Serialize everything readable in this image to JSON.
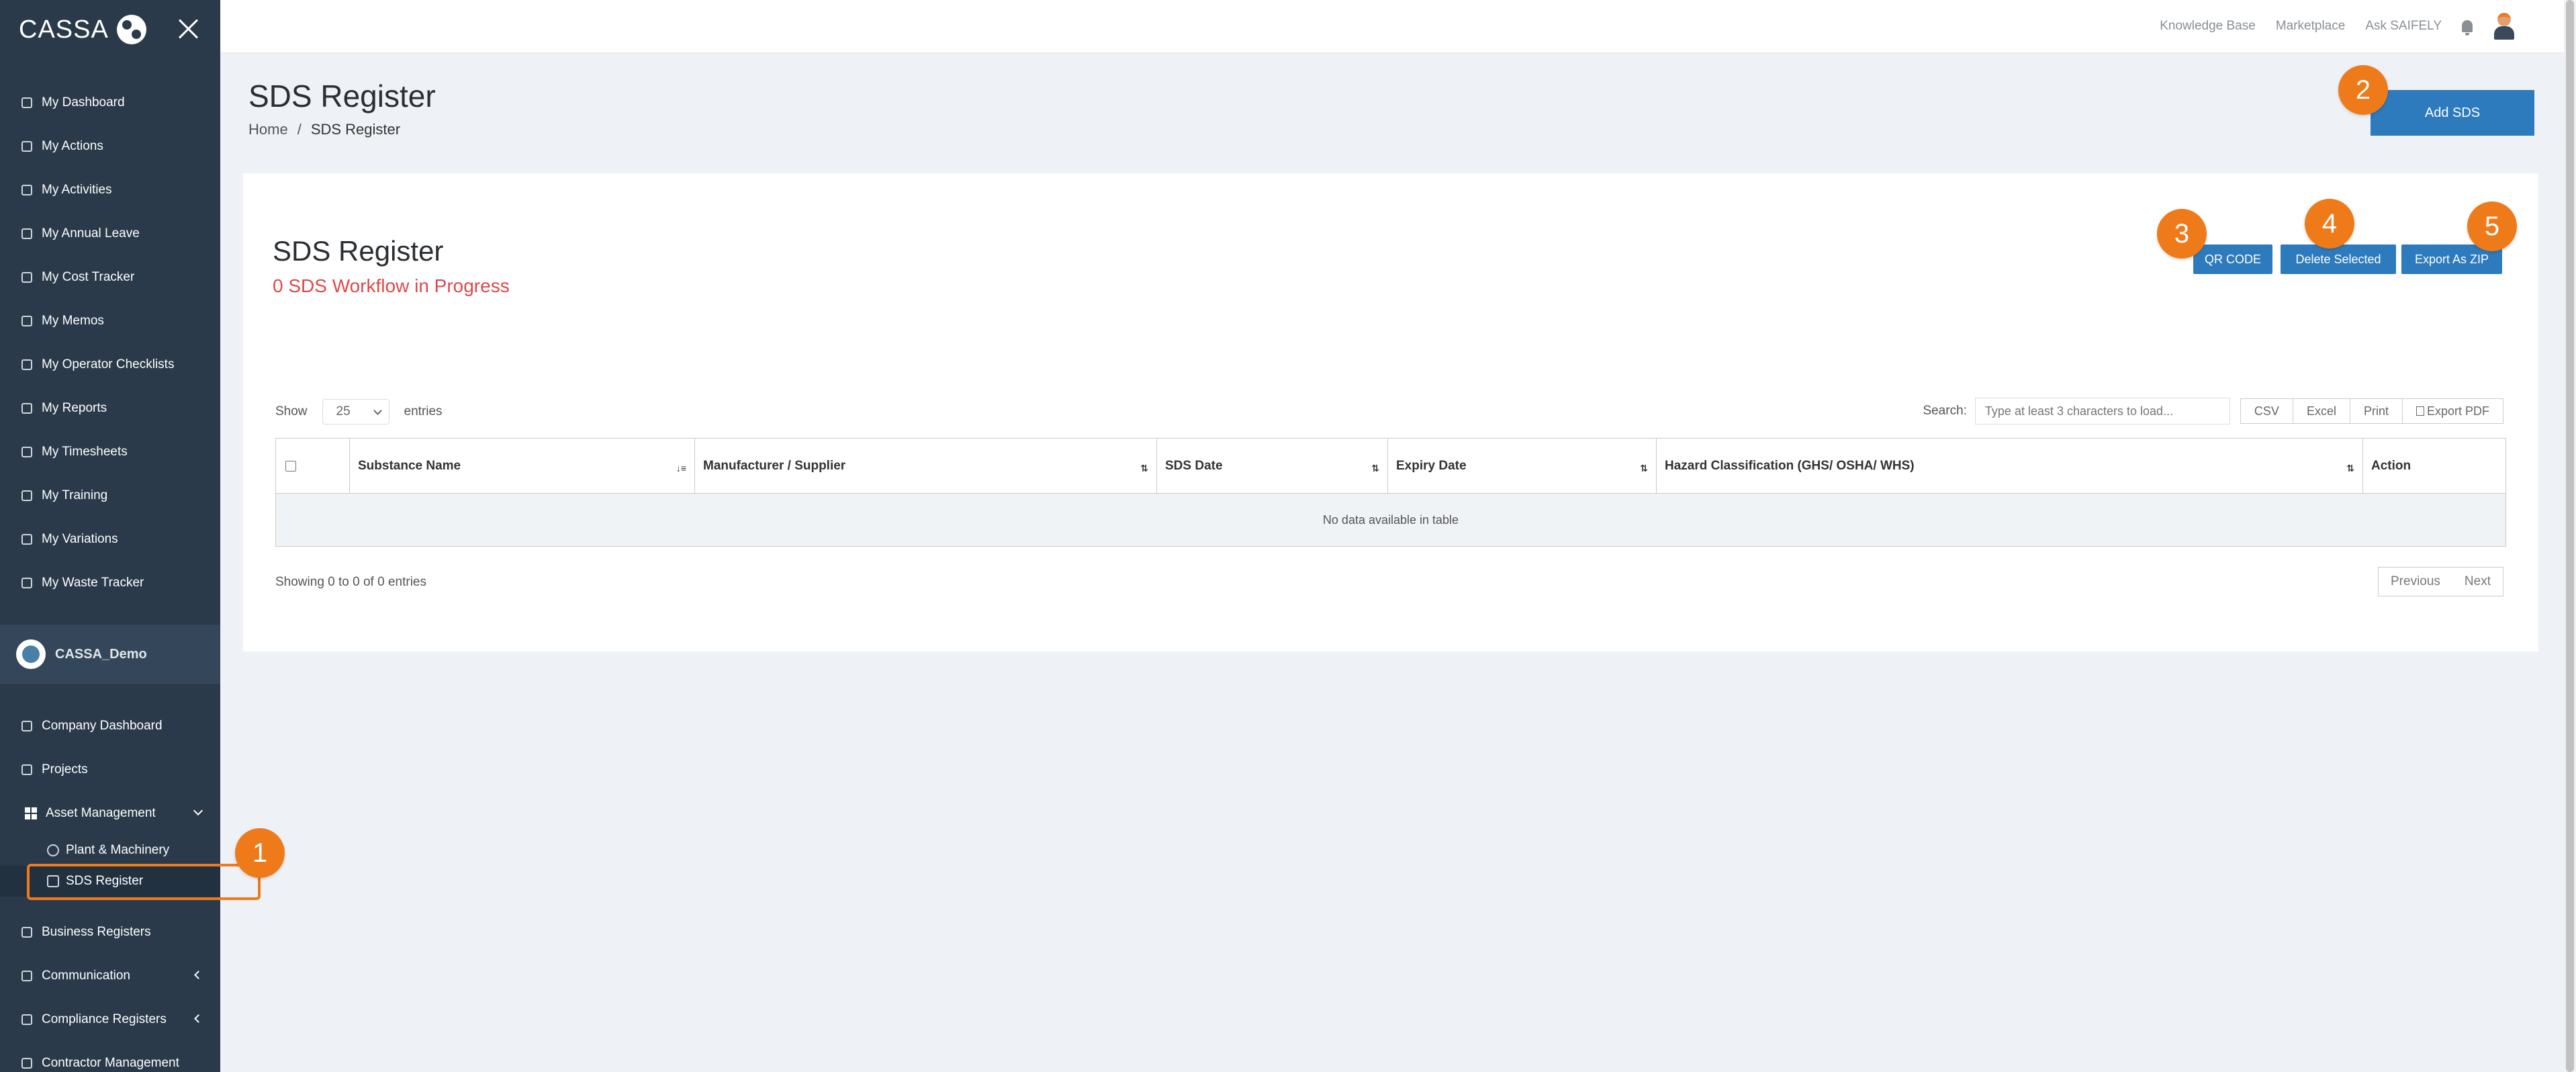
{
  "app": {
    "logo_text": "CASSA"
  },
  "sidebar": {
    "personal_items": [
      {
        "label": "My Dashboard"
      },
      {
        "label": "My Actions"
      },
      {
        "label": "My Activities"
      },
      {
        "label": "My Annual Leave"
      },
      {
        "label": "My Cost Tracker"
      },
      {
        "label": "My Memos"
      },
      {
        "label": "My Operator Checklists"
      },
      {
        "label": "My Reports"
      },
      {
        "label": "My Timesheets"
      },
      {
        "label": "My Training"
      },
      {
        "label": "My Variations"
      },
      {
        "label": "My Waste Tracker"
      }
    ],
    "org_name": "CASSA_Demo",
    "company_items": [
      {
        "label": "Company Dashboard"
      },
      {
        "label": "Projects"
      },
      {
        "label": "Asset Management"
      },
      {
        "label": "Plant & Machinery"
      },
      {
        "label": "SDS Register"
      },
      {
        "label": "Business Registers"
      },
      {
        "label": "Communication"
      },
      {
        "label": "Compliance Registers"
      },
      {
        "label": "Contractor Management"
      }
    ]
  },
  "topbar": {
    "links": [
      "Knowledge Base",
      "Marketplace",
      "Ask SAIFELY"
    ]
  },
  "page": {
    "title": "SDS Register",
    "breadcrumb_home": "Home",
    "breadcrumb_sep": "/",
    "breadcrumb_current": "SDS Register",
    "add_button": "Add SDS"
  },
  "card": {
    "title": "SDS Register",
    "subtitle": "0 SDS Workflow in Progress",
    "qr_button": "QR CODE",
    "delete_button": "Delete Selected",
    "export_zip_button": "Export As ZIP"
  },
  "table_controls": {
    "show_label": "Show",
    "page_size": "25",
    "entries_label": "entries",
    "search_label": "Search:",
    "search_placeholder": "Type at least 3 characters to load...",
    "export_buttons": [
      "CSV",
      "Excel",
      "Print",
      "Export PDF"
    ]
  },
  "table": {
    "columns": [
      "Substance Name",
      "Manufacturer / Supplier",
      "SDS Date",
      "Expiry Date",
      "Hazard Classification (GHS/ OSHA/ WHS)",
      "Action"
    ],
    "empty_text": "No data available in table",
    "info": "Showing 0 to 0 of 0 entries",
    "prev": "Previous",
    "next": "Next"
  },
  "annotations": [
    "1",
    "2",
    "3",
    "4",
    "5"
  ],
  "colors": {
    "accent": "#2d7bbd",
    "sidebar": "#2a3a4a",
    "annotation": "#ef7a1a",
    "alert": "#e04848"
  }
}
